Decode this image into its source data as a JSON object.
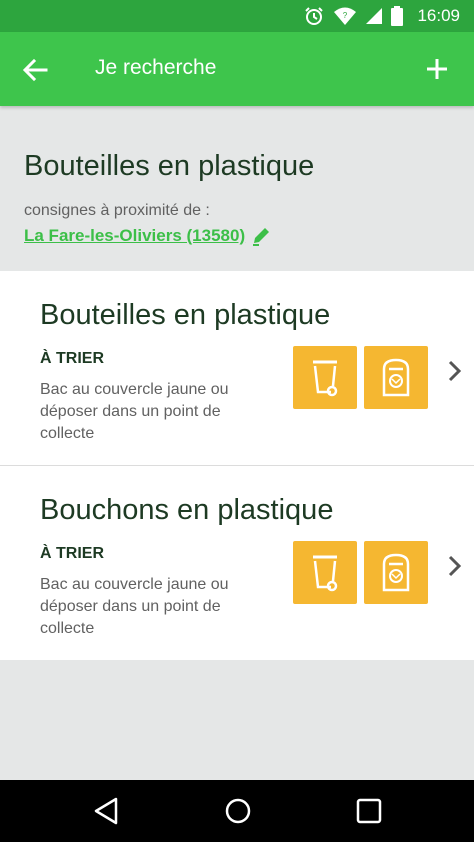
{
  "status": {
    "time": "16:09"
  },
  "appbar": {
    "title": "Je recherche"
  },
  "header": {
    "title": "Bouteilles en plastique",
    "consignes_label": "consignes à proximité de :",
    "location": "La Fare-les-Oliviers (13580)"
  },
  "items": [
    {
      "title": "Bouteilles en plastique",
      "action": "À TRIER",
      "description": "Bac au couvercle jaune ou déposer dans un point de collecte"
    },
    {
      "title": "Bouchons en plastique",
      "action": "À TRIER",
      "description": "Bac au couvercle jaune ou déposer dans un point de collecte"
    }
  ],
  "colors": {
    "status_bar": "#2da53e",
    "app_bar": "#3ec54c",
    "accent": "#3cbf48",
    "bin_button": "#f5b731",
    "title_text": "#1d3a23"
  },
  "icons": [
    "alarm-icon",
    "wifi-icon",
    "signal-icon",
    "battery-icon",
    "arrow-back-icon",
    "plus-icon",
    "pencil-icon",
    "trash-bin-icon",
    "recycling-container-icon",
    "chevron-right-icon",
    "nav-back-icon",
    "nav-home-icon",
    "nav-recents-icon"
  ]
}
